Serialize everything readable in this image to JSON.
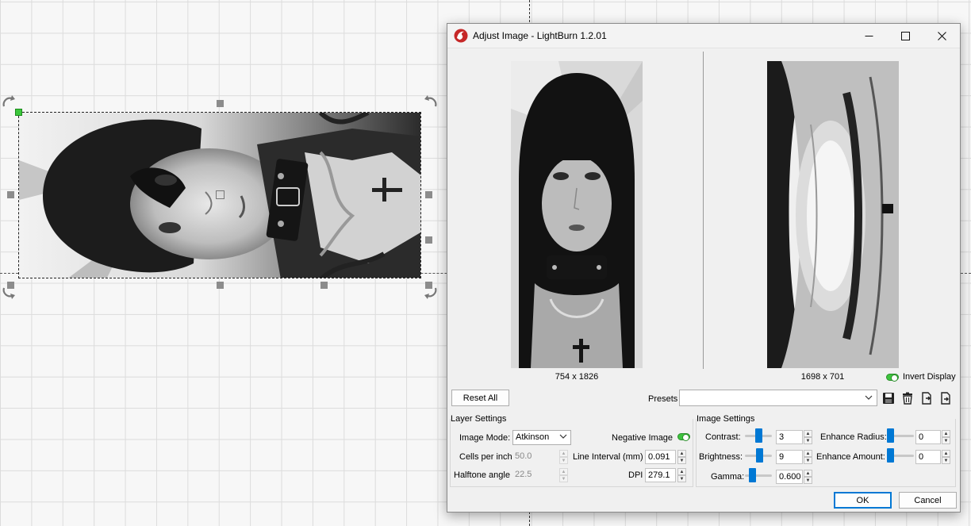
{
  "window": {
    "title": "Adjust Image - LightBurn 1.2.01"
  },
  "preview": {
    "original_size": "754 x 1826",
    "processed_size": "1698 x 701",
    "invert_display_label": "Invert Display",
    "invert_display_on": true
  },
  "toolbar": {
    "reset_all_label": "Reset All",
    "presets_label": "Presets",
    "presets_value": "",
    "icons": [
      "save-icon",
      "delete-icon",
      "import-icon",
      "export-icon"
    ]
  },
  "layer_settings": {
    "title": "Layer Settings",
    "image_mode_label": "Image Mode:",
    "image_mode_value": "Atkinson",
    "negative_image_label": "Negative Image",
    "negative_image_on": true,
    "cells_per_inch_label": "Cells per inch",
    "cells_per_inch_value": "50.0",
    "line_interval_label": "Line Interval (mm)",
    "line_interval_value": "0.091",
    "halftone_angle_label": "Halftone angle",
    "halftone_angle_value": "22.5",
    "dpi_label": "DPI",
    "dpi_value": "279.1"
  },
  "image_settings": {
    "title": "Image Settings",
    "contrast_label": "Contrast:",
    "contrast_value": "3",
    "contrast_level": 0.53,
    "brightness_label": "Brightness:",
    "brightness_value": "9",
    "brightness_level": 0.55,
    "gamma_label": "Gamma:",
    "gamma_value": "0.600",
    "gamma_level": 0.2,
    "enhance_radius_label": "Enhance Radius:",
    "enhance_radius_value": "0",
    "enhance_radius_level": 0.0,
    "enhance_amount_label": "Enhance Amount:",
    "enhance_amount_value": "0",
    "enhance_amount_level": 0.0
  },
  "footer": {
    "ok_label": "OK",
    "cancel_label": "Cancel"
  },
  "colors": {
    "accent": "#0078d4",
    "toggle_on": "#3ec43e",
    "selection_handle": "#3cc73c"
  }
}
